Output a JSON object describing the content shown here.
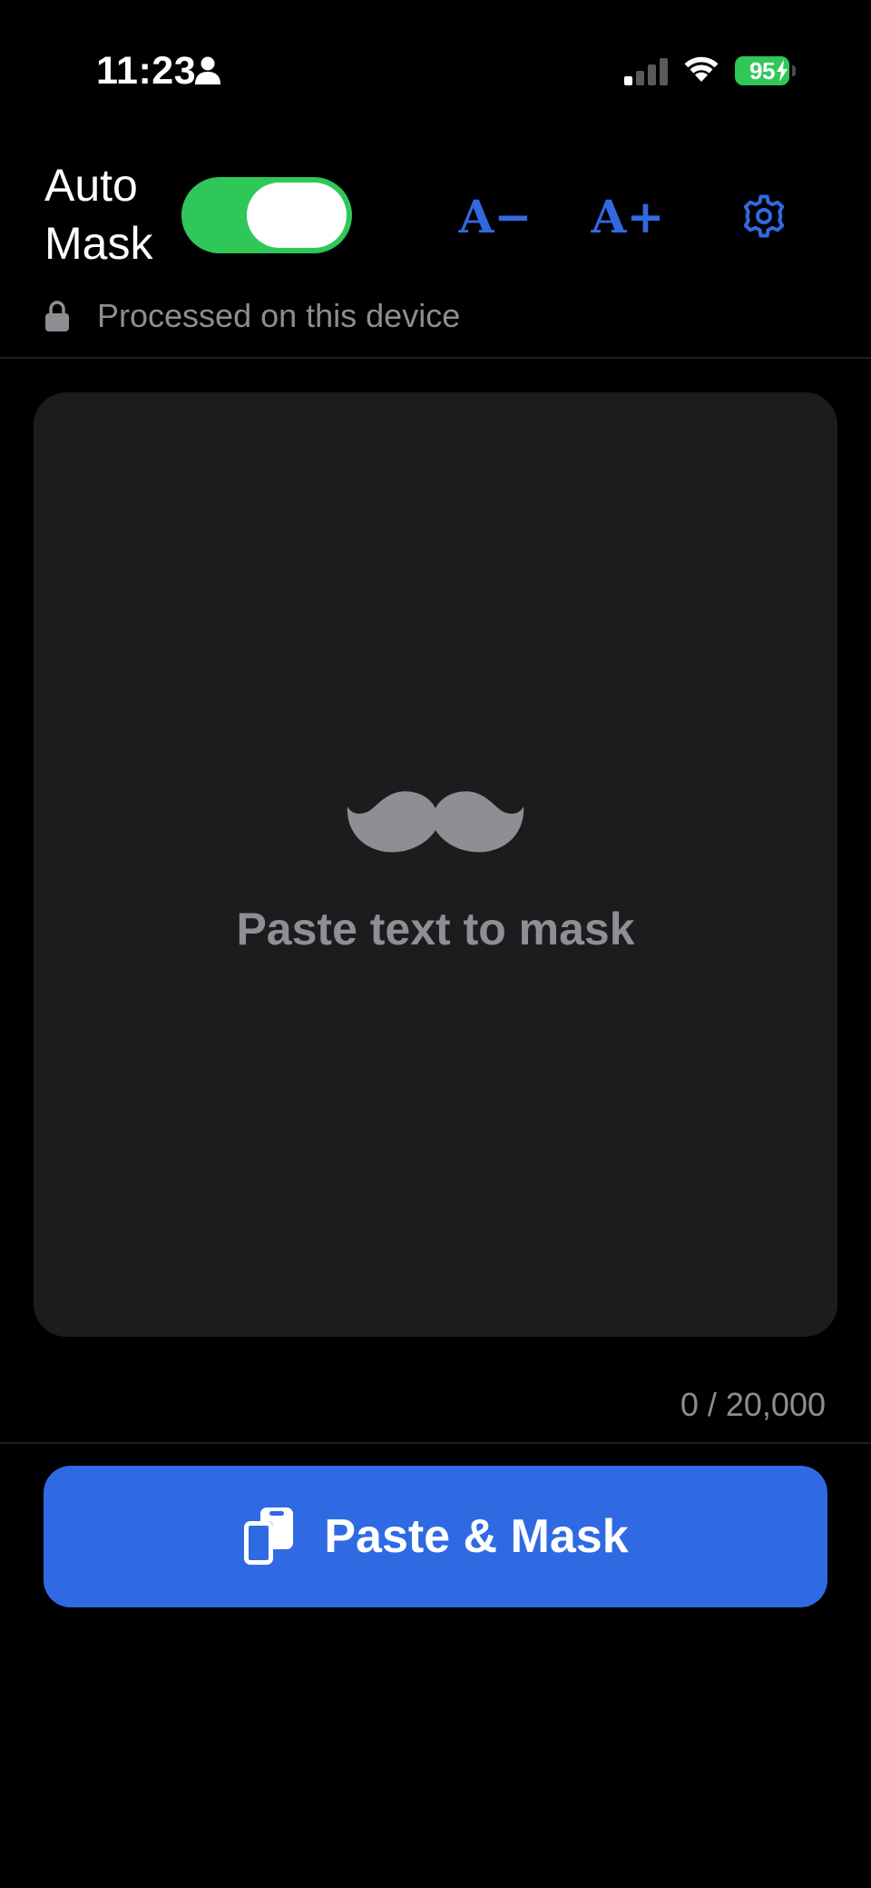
{
  "status_bar": {
    "time": "11:23",
    "battery_level": "95",
    "icons": [
      "person-icon",
      "cellular-signal-icon",
      "wifi-icon",
      "battery-icon",
      "charging-bolt-icon"
    ]
  },
  "header": {
    "auto_mask": {
      "label_line1": "Auto",
      "label_line2": "Mask",
      "enabled": true
    },
    "font_decrease_label": "A−",
    "font_increase_label": "A+",
    "settings_icon": "gear-icon"
  },
  "privacy": {
    "icon": "lock-icon",
    "text": "Processed on this device"
  },
  "paste_area": {
    "icon": "mustache-icon",
    "hint": "Paste text to mask"
  },
  "char_count": "0 / 20,000",
  "action": {
    "icon": "clipboard-icon",
    "label": "Paste & Mask"
  },
  "colors": {
    "background": "#000000",
    "accent": "#3269e0",
    "toggle_on": "#30c759",
    "card": "#1c1c1e",
    "secondary_text": "#8d8d92"
  }
}
